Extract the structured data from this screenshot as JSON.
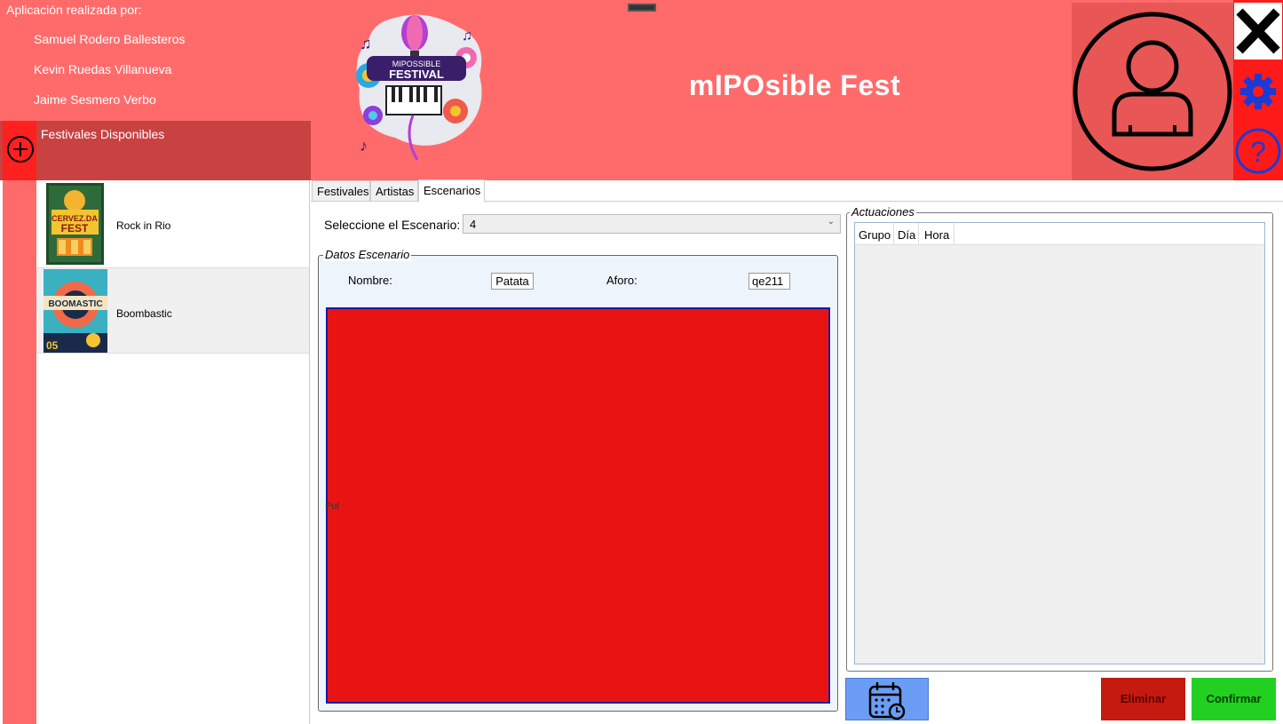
{
  "header": {
    "credits_title": "Aplicación realizada por:",
    "credits": [
      "Samuel Rodero Ballesteros",
      "Kevin Ruedas Villanueva",
      "Jaime Sesmero Verbo"
    ],
    "festivales_label": "Festivales Disponibles",
    "logo_text": [
      "MIPOSSIBLE",
      "FESTIVAL"
    ],
    "app_title": "mIPOsible Fest"
  },
  "icons": {
    "add": "plus-circle-icon",
    "avatar": "user-avatar-icon",
    "close": "close-icon",
    "settings": "gear-icon",
    "help": "help-icon",
    "calendar": "calendar-icon"
  },
  "festivals": [
    {
      "name": "Rock in Rio",
      "poster_text": "CERVEZ.DA FEST"
    },
    {
      "name": "Boombastic",
      "poster_text": "BOOMASTIC"
    }
  ],
  "tabs": [
    {
      "label": "Festivales"
    },
    {
      "label": "Artistas"
    },
    {
      "label": "Escenarios"
    }
  ],
  "escenarios": {
    "select_label": "Seleccione el Escenario:",
    "selected_value": "4",
    "datos_legend": "Datos Escenario",
    "nombre_label": "Nombre:",
    "nombre_value": "Patata",
    "aforo_label": "Aforo:",
    "aforo_value": "qe211",
    "pul_label": "Pul",
    "actuaciones_legend": "Actuaciones",
    "columns": [
      "Grupo",
      "Día",
      "Hora"
    ]
  },
  "buttons": {
    "eliminar": "Eliminar",
    "confirmar": "Confirmar"
  },
  "colors": {
    "header": "#ff6b6b",
    "festivales_panel": "#c94242",
    "accent_red": "#e81414",
    "confirm_green": "#22d022",
    "delete_red": "#c41a10",
    "calendar_blue": "#6b9df5"
  }
}
